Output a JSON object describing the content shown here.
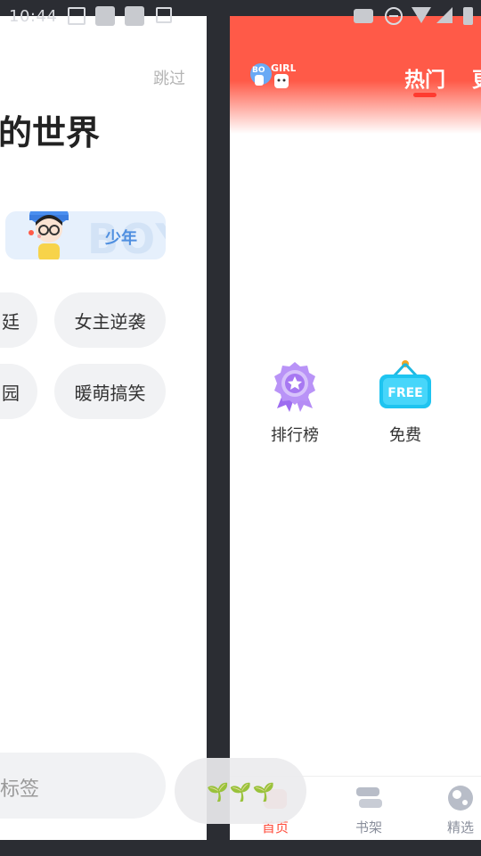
{
  "status_bar": {
    "time": "10:44"
  },
  "onboarding": {
    "skip_label": "跳过",
    "title": "的世界",
    "youth": {
      "watermark": "BOY",
      "label": "少年"
    },
    "tags": [
      "廷",
      "女主逆袭",
      "园",
      "暖萌搞笑"
    ],
    "bottom_button": "标签"
  },
  "home": {
    "logo_text": "BOY GIRL",
    "tabs": [
      {
        "label": "热门",
        "active": true
      },
      {
        "label": "更",
        "active": false
      }
    ],
    "features": [
      {
        "label": "排行榜",
        "icon": "ribbon-medal-icon"
      },
      {
        "label": "免费",
        "badge": "FREE",
        "icon": "free-sign-icon"
      }
    ],
    "bottom_nav": [
      {
        "label": "首页",
        "active": true,
        "icon": "home-icon"
      },
      {
        "label": "书架",
        "active": false,
        "icon": "bookshelf-icon"
      },
      {
        "label": "精选",
        "active": false,
        "icon": "featured-icon"
      }
    ]
  },
  "overlay": {
    "sprouts": "🌱🌱🌱"
  },
  "colors": {
    "accent": "#ff5a48",
    "tab_active": "#ff3b30",
    "youth_blue": "#4f8fe0"
  }
}
